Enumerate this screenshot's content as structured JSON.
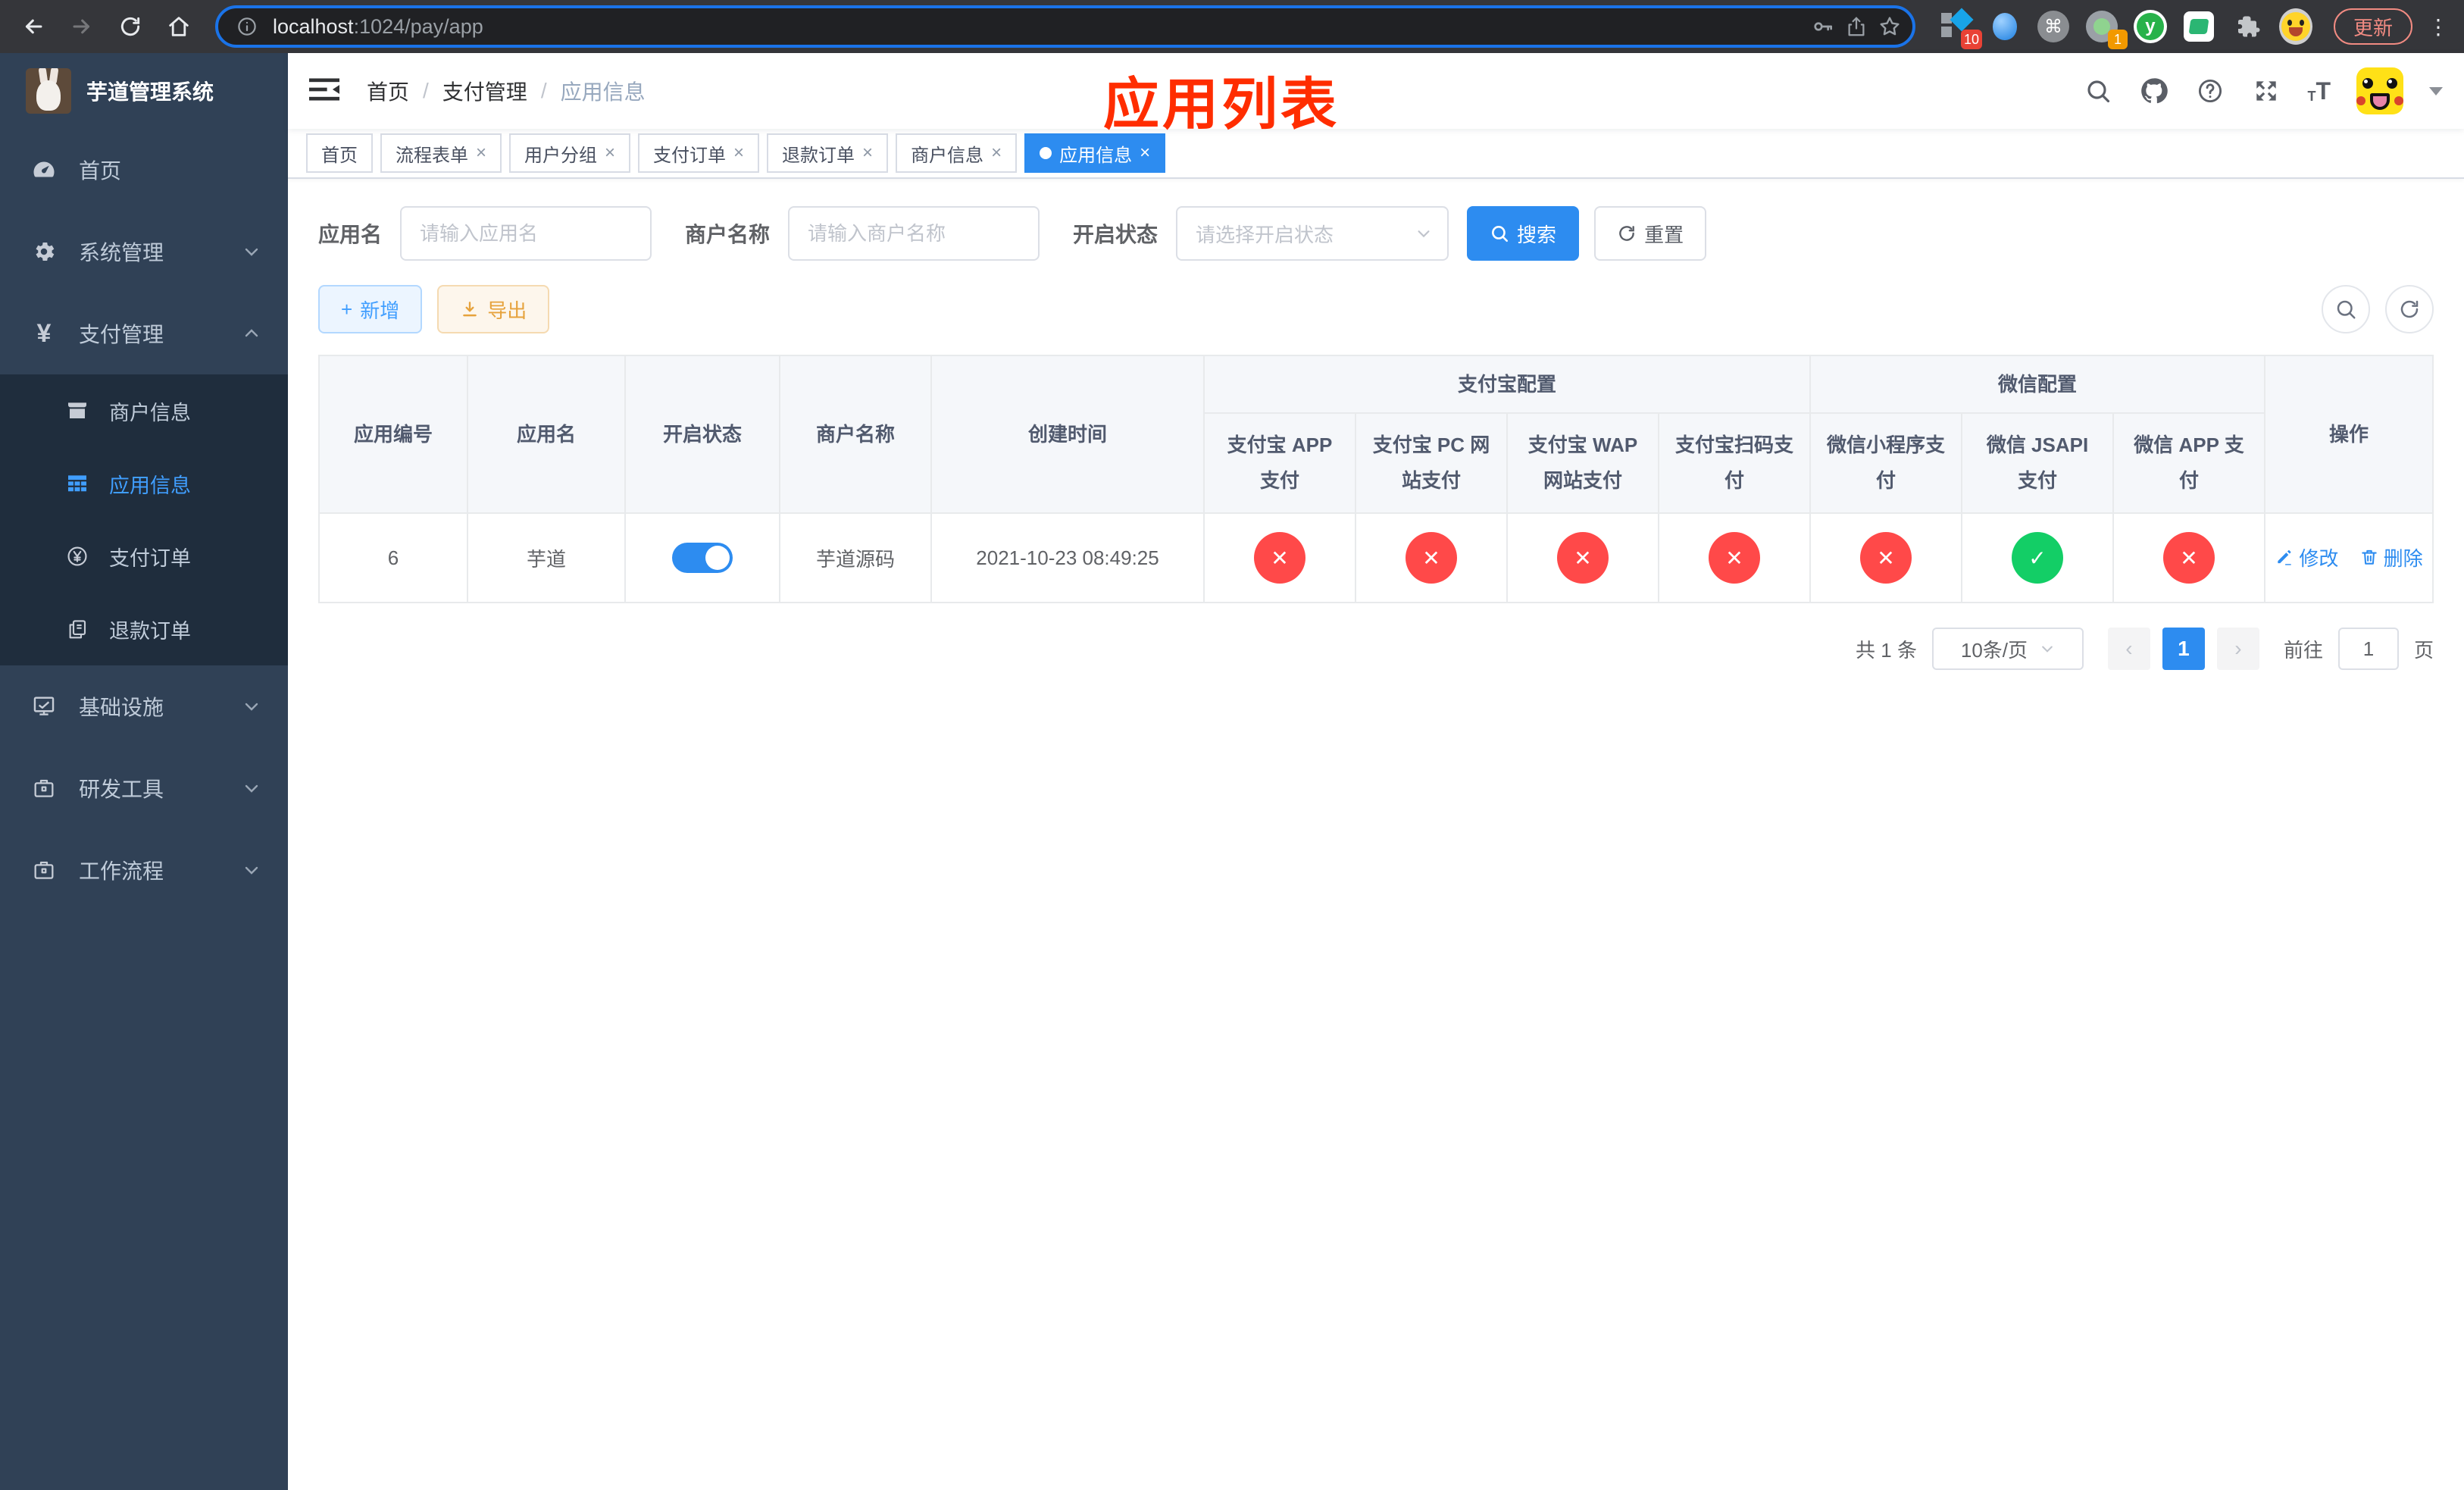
{
  "browser": {
    "url_host": "localhost",
    "url_path": ":1024/pay/app",
    "update_button": "更新",
    "ext_badge_apps": "10",
    "ext_badge_green": "1",
    "cmd_glyph": "⌘",
    "y_glyph": "y",
    "kebab_glyph": "⋮"
  },
  "sidebar": {
    "title": "芋道管理系统",
    "menu": [
      {
        "label": "首页"
      },
      {
        "label": "系统管理"
      },
      {
        "label": "支付管理"
      },
      {
        "label": "基础设施"
      },
      {
        "label": "研发工具"
      },
      {
        "label": "工作流程"
      }
    ],
    "submenu": [
      {
        "label": "商户信息"
      },
      {
        "label": "应用信息"
      },
      {
        "label": "支付订单"
      },
      {
        "label": "退款订单"
      }
    ],
    "yen_glyph": "¥"
  },
  "navbar": {
    "breadcrumb": [
      "首页",
      "支付管理",
      "应用信息"
    ],
    "separator": "/",
    "annotation": "应用列表"
  },
  "tabs": [
    {
      "label": "首页"
    },
    {
      "label": "流程表单"
    },
    {
      "label": "用户分组"
    },
    {
      "label": "支付订单"
    },
    {
      "label": "退款订单"
    },
    {
      "label": "商户信息"
    },
    {
      "label": "应用信息"
    }
  ],
  "close_glyph": "×",
  "filters": {
    "app_name_label": "应用名",
    "app_name_placeholder": "请输入应用名",
    "merchant_label": "商户名称",
    "merchant_placeholder": "请输入商户名称",
    "status_label": "开启状态",
    "status_placeholder": "请选择开启状态",
    "search_button": "搜索",
    "reset_button": "重置"
  },
  "toolbar": {
    "add_button": "新增",
    "export_button": "导出",
    "add_glyph": "+"
  },
  "table": {
    "columns": {
      "app_id": "应用编号",
      "app_name": "应用名",
      "status": "开启状态",
      "merchant": "商户名称",
      "created": "创建时间",
      "alipay_group": "支付宝配置",
      "wechat_group": "微信配置",
      "alipay_app": "支付宝 APP 支付",
      "alipay_pc": "支付宝 PC 网站支付",
      "alipay_wap": "支付宝 WAP 网站支付",
      "alipay_qr": "支付宝扫码支付",
      "wx_mini": "微信小程序支付",
      "wx_jsapi": "微信 JSAPI 支付",
      "wx_app": "微信 APP 支付",
      "actions": "操作"
    },
    "row": {
      "app_id": "6",
      "app_name": "芋道",
      "status_on": true,
      "merchant": "芋道源码",
      "created": "2021-10-23 08:49:25",
      "configs": [
        false,
        false,
        false,
        false,
        false,
        true,
        false
      ],
      "edit_label": "修改",
      "delete_label": "删除"
    },
    "check_glyph": "✓",
    "cross_glyph": "✕"
  },
  "pagination": {
    "total": "共 1 条",
    "page_size": "10条/页",
    "prev_glyph": "‹",
    "next_glyph": "›",
    "current_page": "1",
    "goto_label": "前往",
    "goto_value": "1",
    "page_unit": "页"
  },
  "colors": {
    "primary": "#2d8cf0",
    "link": "#409eff",
    "success": "#13ce66",
    "danger": "#ff4949",
    "warning": "#e6a23c",
    "sidebar_bg": "#304156",
    "submenu_bg": "#1f2d3d",
    "annotation": "#ff2d00"
  }
}
